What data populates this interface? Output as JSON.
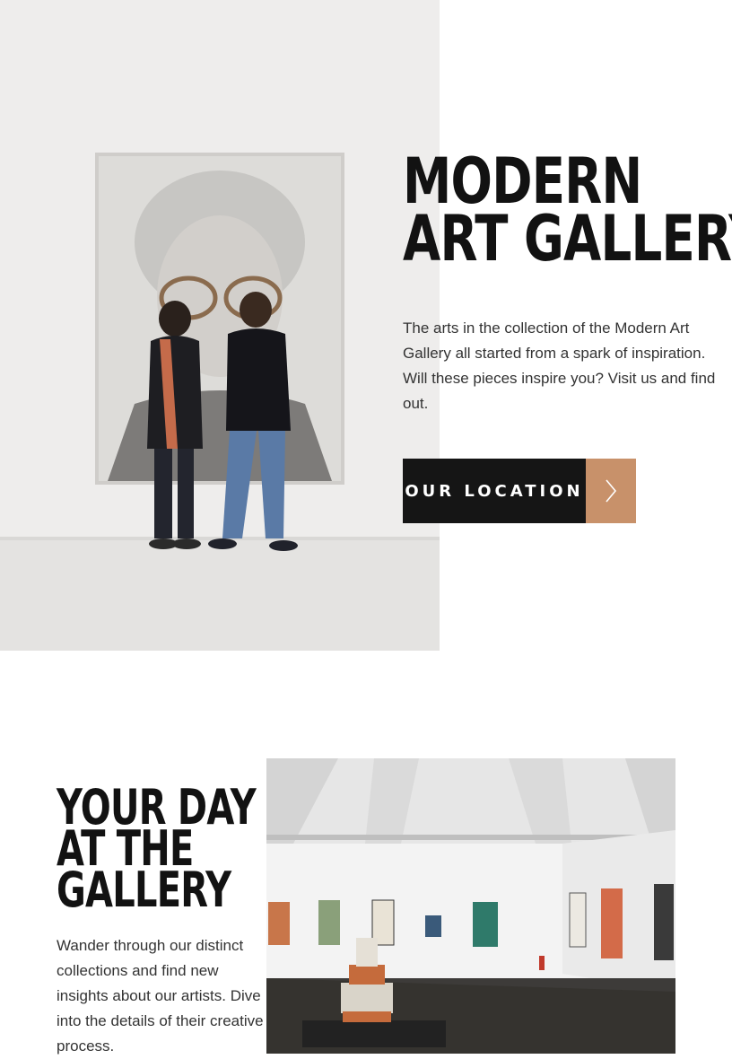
{
  "hero": {
    "title_line1": "MODERN",
    "title_line2": "ART GALLERY",
    "description": "The arts in the collection of the Modern Art Gallery all started from a spark of inspiration. Will these pieces inspire you? Visit us and find out.",
    "cta_label": "OUR LOCATION",
    "cta_icon": "chevron-right-icon",
    "image_subject": "visitors-viewing-portrait-photo"
  },
  "section2": {
    "title_line1": "YOUR DAY",
    "title_line2": "AT THE",
    "title_line3": "GALLERY",
    "description": "Wander through our distinct collections and find new insights about our artists. Dive into the details of their creative process.",
    "image_subject": "gallery-interior-photo"
  },
  "colors": {
    "dark": "#151515",
    "accent": "#c8916a",
    "text": "#333333",
    "background": "#ffffff"
  }
}
